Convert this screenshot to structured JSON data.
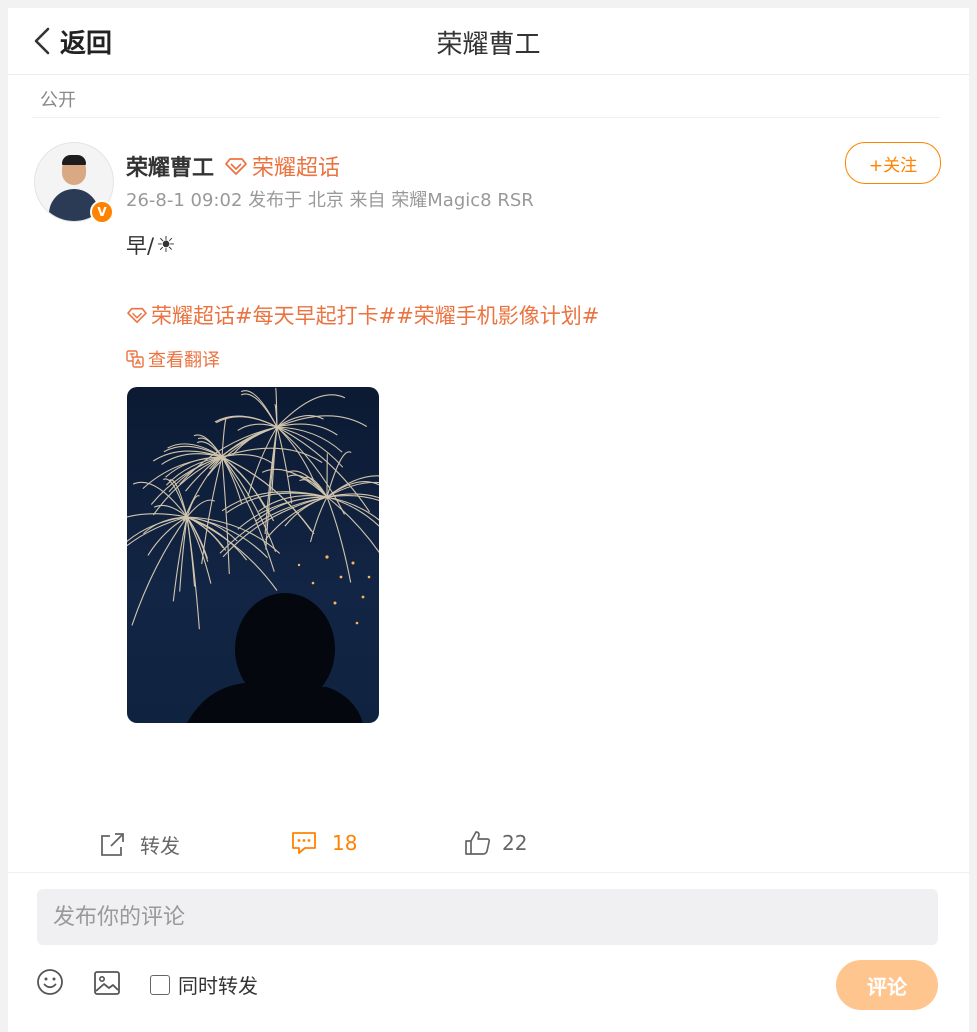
{
  "header": {
    "back_label": "返回",
    "title": "荣耀曹工"
  },
  "post": {
    "visibility": "公开",
    "author": {
      "name": "荣耀曹工",
      "supertopic": "荣耀超话",
      "verified_badge": "V"
    },
    "meta": "26-8-1 09:02 发布于 北京 来自 荣耀Magic8 RSR",
    "follow_label": "+关注",
    "text": "早/",
    "text_emoji": "☀",
    "hashtags": {
      "supertopic": "荣耀超话",
      "tag1": "#每天早起打卡#",
      "tag2": "#荣耀手机影像计划#"
    },
    "translate_label": "查看翻译",
    "image_alt": "fireworks photo",
    "actions": {
      "repost_label": "转发",
      "comment_count": "18",
      "like_count": "22"
    }
  },
  "composer": {
    "placeholder": "发布你的评论",
    "repost_checkbox_label": "同时转发",
    "submit_label": "评论"
  },
  "colors": {
    "accent": "#ff8200",
    "topic": "#eb7340",
    "submit_disabled": "#ffc58f"
  }
}
